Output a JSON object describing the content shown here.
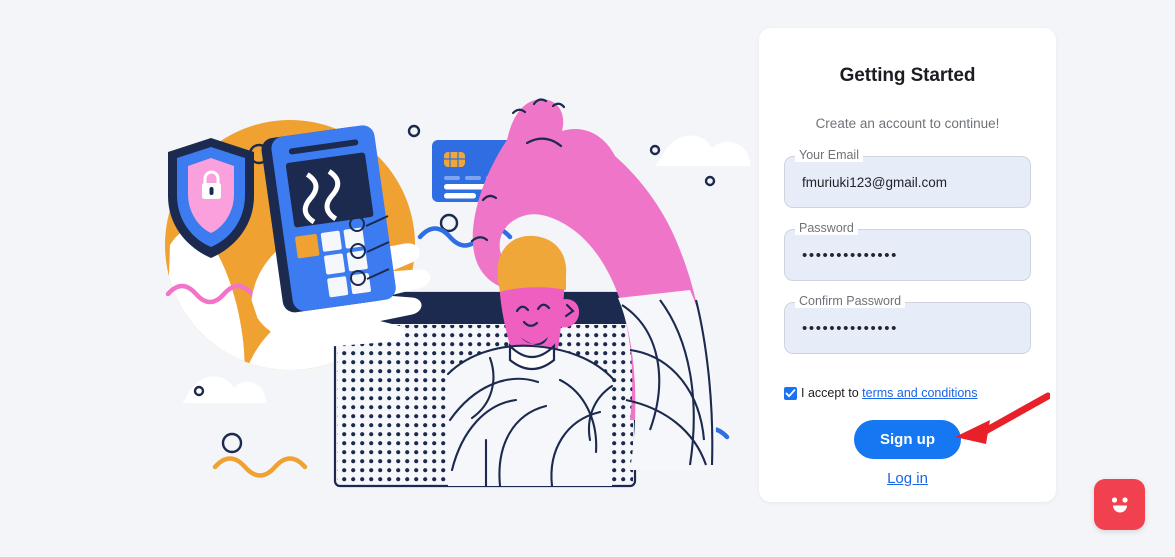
{
  "page": {
    "background_color": "#f4f5f9"
  },
  "illustration": {
    "name": "secure-online-payment-illustration",
    "colors": {
      "orange": "#efa231",
      "navy": "#1b2a4e",
      "blue": "#2f6de2",
      "pink": "#f273c9",
      "magenta": "#ef5fc0",
      "white": "#ffffff"
    },
    "elements": [
      "security-shield-lock",
      "hand-holding-payment-terminal",
      "credit-card",
      "pink-arm-holding-card",
      "browser-window",
      "person-character",
      "decorative-clouds",
      "decorative-circles",
      "decorative-waves"
    ]
  },
  "card": {
    "title": "Getting Started",
    "subtitle": "Create an account to continue!",
    "fields": [
      {
        "label": "Your Email",
        "value": "fmuriuki123@gmail.com",
        "type": "email"
      },
      {
        "label": "Password",
        "value": "••••••••••••••",
        "type": "password"
      },
      {
        "label": "Confirm Password",
        "value": "••••••••••••••",
        "type": "password"
      }
    ],
    "terms": {
      "checked": true,
      "text": "I accept to",
      "link_text": "terms and conditions"
    },
    "signup_label": "Sign up",
    "login_label": "Log in",
    "accent_color": "#1677f2",
    "field_fill_color": "#e7ecf9"
  },
  "annotation": {
    "arrow_color": "#e8202a",
    "points_to": "Sign up"
  },
  "chat_widget": {
    "icon": "chat-smiley-icon",
    "color": "#f2414e"
  }
}
